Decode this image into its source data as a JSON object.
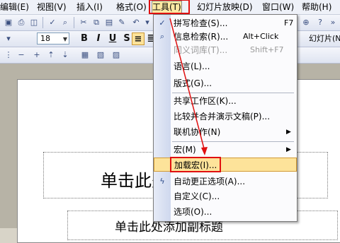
{
  "menubar": {
    "items": [
      {
        "label": "编辑(E)"
      },
      {
        "label": "视图(V)"
      },
      {
        "label": "插入(I)"
      },
      {
        "label": "格式(O)"
      },
      {
        "label": "工具(T)"
      },
      {
        "label": "幻灯片放映(D)"
      },
      {
        "label": "窗口(W)"
      },
      {
        "label": "帮助(H)"
      }
    ]
  },
  "toolbar": {
    "font_size": "18",
    "bold_label": "B",
    "italic_label": "I",
    "underline_label": "U",
    "shadow_label": "S",
    "slide_label": "幻灯片(N)"
  },
  "tools_menu": {
    "items": [
      {
        "label": "拼写检查(S)...",
        "shortcut": "F7",
        "icon": "spell-check-icon"
      },
      {
        "label": "信息检索(R)...",
        "shortcut": "Alt+Click",
        "icon": "research-icon"
      },
      {
        "label": "同义词库(T)...",
        "shortcut": "Shift+F7",
        "disabled": true
      },
      {
        "label": "语言(L)..."
      },
      {
        "label": "版式(G)..."
      },
      {
        "label": "共享工作区(K)..."
      },
      {
        "label": "比较并合并演示文稿(P)..."
      },
      {
        "label": "联机协作(N)",
        "submenu": true
      },
      {
        "label": "宏(M)",
        "submenu": true
      },
      {
        "label": "加载宏(I)..."
      },
      {
        "label": "自动更正选项(A)...",
        "icon": "autocorrect-icon"
      },
      {
        "label": "自定义(C)..."
      },
      {
        "label": "选项(O)..."
      }
    ]
  },
  "slide": {
    "title_placeholder": "单击此处添加标题",
    "subtitle_placeholder": "单击此处添加副标题"
  },
  "colors": {
    "annotation_red": "#e01010",
    "menu_highlight": "#fde39a"
  }
}
